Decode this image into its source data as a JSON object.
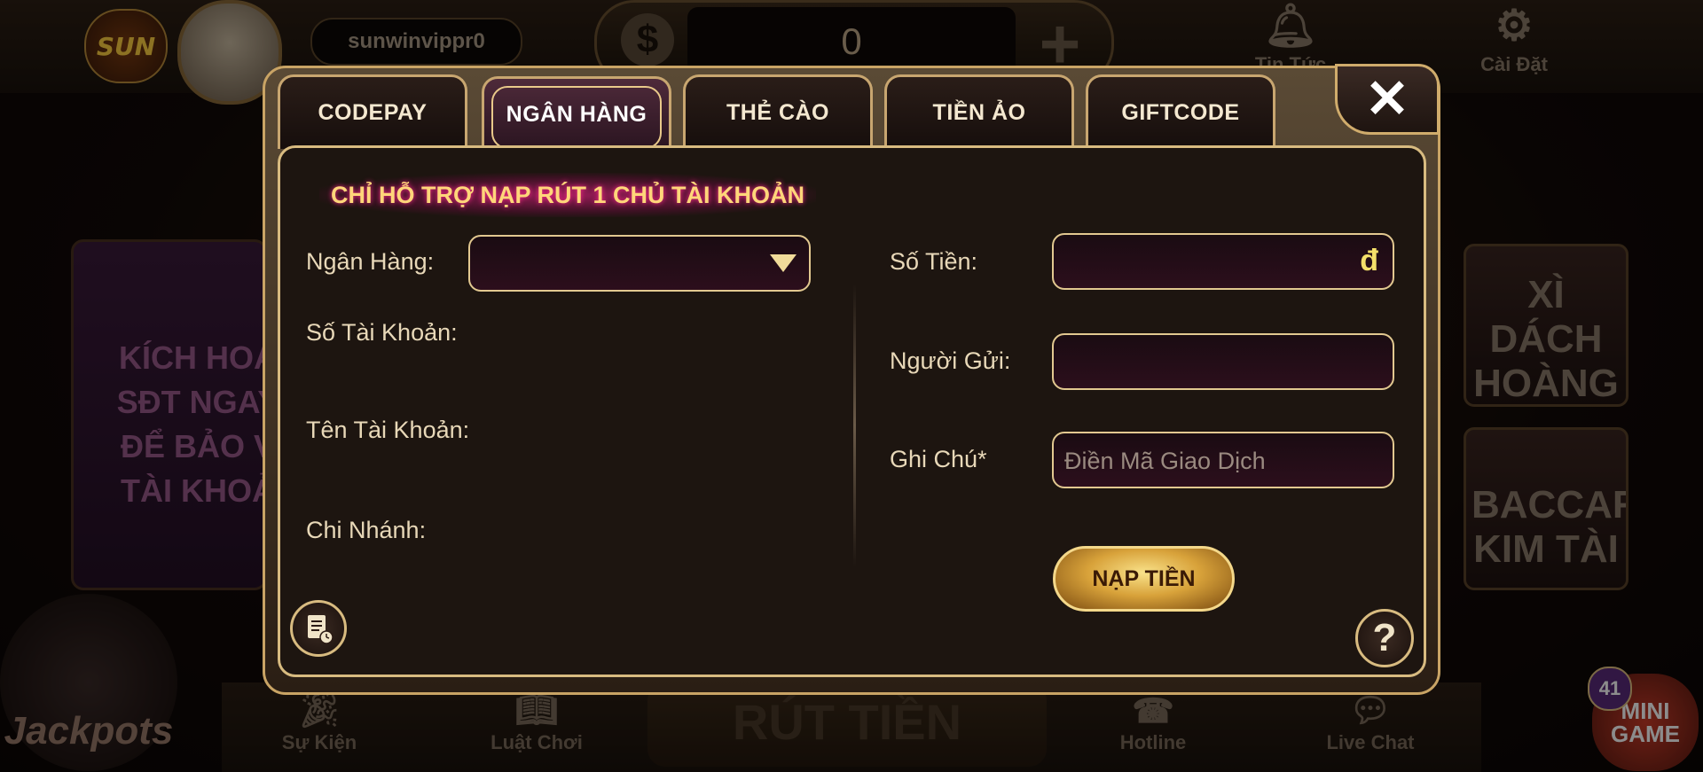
{
  "background": {
    "logo_text": "SUN",
    "username": "sunwinvippr0",
    "balance_symbol": "$",
    "balance": "0",
    "plus_symbol": "+",
    "top_icons": [
      {
        "label": "Tin Tức",
        "icon": "bell-icon"
      },
      {
        "label": "Cài Đặt",
        "icon": "gear-icon"
      }
    ],
    "left_banner_lines": [
      "KÍCH HOẠ",
      "SĐT NGAY",
      "ĐỂ BẢO V",
      "TÀI KHOẢ"
    ],
    "right_cards": [
      "XÌ DÁCH HOÀNG GIA",
      "BACCARAT KIM TÀI"
    ],
    "jackpot_label": "Jackpots",
    "bottom_nav": [
      {
        "label": "Sự Kiện",
        "icon": "party-icon"
      },
      {
        "label": "Luật Chơi",
        "icon": "book-icon"
      },
      {
        "label": "Hotline",
        "icon": "phone-icon"
      },
      {
        "label": "Live Chat",
        "icon": "chat-icon"
      }
    ],
    "center_bottom_label": "RÚT TIỀN",
    "minigame_label": "MINI GAME",
    "minigame_badge": "41"
  },
  "modal": {
    "tabs": [
      {
        "label": "CODEPAY",
        "active": false
      },
      {
        "label": "NGÂN HÀNG",
        "active": true
      },
      {
        "label": "THẺ CÀO",
        "active": false
      },
      {
        "label": "TIỀN ẢO",
        "active": false
      },
      {
        "label": "GIFTCODE",
        "active": false
      }
    ],
    "close_label": "✕",
    "notice": "CHỈ HỖ TRỢ NẠP RÚT 1 CHỦ TÀI KHOẢN",
    "left": {
      "bank_label": "Ngân Hàng:",
      "bank_value": "",
      "account_number_label": "Số Tài Khoản:",
      "account_name_label": "Tên Tài Khoản:",
      "branch_label": "Chi Nhánh:"
    },
    "right": {
      "amount_label": "Số Tiền:",
      "amount_value": "",
      "currency": "đ",
      "sender_label": "Người Gửi:",
      "sender_value": "",
      "note_label": "Ghi Chú*",
      "note_placeholder": "Điền Mã Giao Dịch",
      "submit_label": "NẠP TIỀN"
    },
    "help_label": "?",
    "history_icon": "document-clock-icon"
  },
  "colors": {
    "accent_gold": "#d8bb80",
    "notice_text": "#ffd67a",
    "currency": "#f4e06a"
  }
}
